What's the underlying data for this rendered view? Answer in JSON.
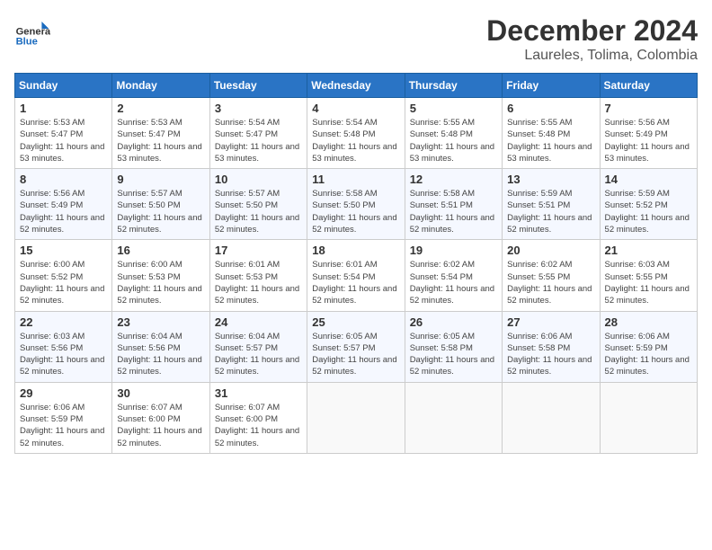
{
  "header": {
    "logo_general": "General",
    "logo_blue": "Blue",
    "month_title": "December 2024",
    "location": "Laureles, Tolima, Colombia"
  },
  "weekdays": [
    "Sunday",
    "Monday",
    "Tuesday",
    "Wednesday",
    "Thursday",
    "Friday",
    "Saturday"
  ],
  "weeks": [
    [
      {
        "day": "1",
        "sunrise": "5:53 AM",
        "sunset": "5:47 PM",
        "daylight": "11 hours and 53 minutes."
      },
      {
        "day": "2",
        "sunrise": "5:53 AM",
        "sunset": "5:47 PM",
        "daylight": "11 hours and 53 minutes."
      },
      {
        "day": "3",
        "sunrise": "5:54 AM",
        "sunset": "5:47 PM",
        "daylight": "11 hours and 53 minutes."
      },
      {
        "day": "4",
        "sunrise": "5:54 AM",
        "sunset": "5:48 PM",
        "daylight": "11 hours and 53 minutes."
      },
      {
        "day": "5",
        "sunrise": "5:55 AM",
        "sunset": "5:48 PM",
        "daylight": "11 hours and 53 minutes."
      },
      {
        "day": "6",
        "sunrise": "5:55 AM",
        "sunset": "5:48 PM",
        "daylight": "11 hours and 53 minutes."
      },
      {
        "day": "7",
        "sunrise": "5:56 AM",
        "sunset": "5:49 PM",
        "daylight": "11 hours and 53 minutes."
      }
    ],
    [
      {
        "day": "8",
        "sunrise": "5:56 AM",
        "sunset": "5:49 PM",
        "daylight": "11 hours and 52 minutes."
      },
      {
        "day": "9",
        "sunrise": "5:57 AM",
        "sunset": "5:50 PM",
        "daylight": "11 hours and 52 minutes."
      },
      {
        "day": "10",
        "sunrise": "5:57 AM",
        "sunset": "5:50 PM",
        "daylight": "11 hours and 52 minutes."
      },
      {
        "day": "11",
        "sunrise": "5:58 AM",
        "sunset": "5:50 PM",
        "daylight": "11 hours and 52 minutes."
      },
      {
        "day": "12",
        "sunrise": "5:58 AM",
        "sunset": "5:51 PM",
        "daylight": "11 hours and 52 minutes."
      },
      {
        "day": "13",
        "sunrise": "5:59 AM",
        "sunset": "5:51 PM",
        "daylight": "11 hours and 52 minutes."
      },
      {
        "day": "14",
        "sunrise": "5:59 AM",
        "sunset": "5:52 PM",
        "daylight": "11 hours and 52 minutes."
      }
    ],
    [
      {
        "day": "15",
        "sunrise": "6:00 AM",
        "sunset": "5:52 PM",
        "daylight": "11 hours and 52 minutes."
      },
      {
        "day": "16",
        "sunrise": "6:00 AM",
        "sunset": "5:53 PM",
        "daylight": "11 hours and 52 minutes."
      },
      {
        "day": "17",
        "sunrise": "6:01 AM",
        "sunset": "5:53 PM",
        "daylight": "11 hours and 52 minutes."
      },
      {
        "day": "18",
        "sunrise": "6:01 AM",
        "sunset": "5:54 PM",
        "daylight": "11 hours and 52 minutes."
      },
      {
        "day": "19",
        "sunrise": "6:02 AM",
        "sunset": "5:54 PM",
        "daylight": "11 hours and 52 minutes."
      },
      {
        "day": "20",
        "sunrise": "6:02 AM",
        "sunset": "5:55 PM",
        "daylight": "11 hours and 52 minutes."
      },
      {
        "day": "21",
        "sunrise": "6:03 AM",
        "sunset": "5:55 PM",
        "daylight": "11 hours and 52 minutes."
      }
    ],
    [
      {
        "day": "22",
        "sunrise": "6:03 AM",
        "sunset": "5:56 PM",
        "daylight": "11 hours and 52 minutes."
      },
      {
        "day": "23",
        "sunrise": "6:04 AM",
        "sunset": "5:56 PM",
        "daylight": "11 hours and 52 minutes."
      },
      {
        "day": "24",
        "sunrise": "6:04 AM",
        "sunset": "5:57 PM",
        "daylight": "11 hours and 52 minutes."
      },
      {
        "day": "25",
        "sunrise": "6:05 AM",
        "sunset": "5:57 PM",
        "daylight": "11 hours and 52 minutes."
      },
      {
        "day": "26",
        "sunrise": "6:05 AM",
        "sunset": "5:58 PM",
        "daylight": "11 hours and 52 minutes."
      },
      {
        "day": "27",
        "sunrise": "6:06 AM",
        "sunset": "5:58 PM",
        "daylight": "11 hours and 52 minutes."
      },
      {
        "day": "28",
        "sunrise": "6:06 AM",
        "sunset": "5:59 PM",
        "daylight": "11 hours and 52 minutes."
      }
    ],
    [
      {
        "day": "29",
        "sunrise": "6:06 AM",
        "sunset": "5:59 PM",
        "daylight": "11 hours and 52 minutes."
      },
      {
        "day": "30",
        "sunrise": "6:07 AM",
        "sunset": "6:00 PM",
        "daylight": "11 hours and 52 minutes."
      },
      {
        "day": "31",
        "sunrise": "6:07 AM",
        "sunset": "6:00 PM",
        "daylight": "11 hours and 52 minutes."
      },
      null,
      null,
      null,
      null
    ]
  ]
}
